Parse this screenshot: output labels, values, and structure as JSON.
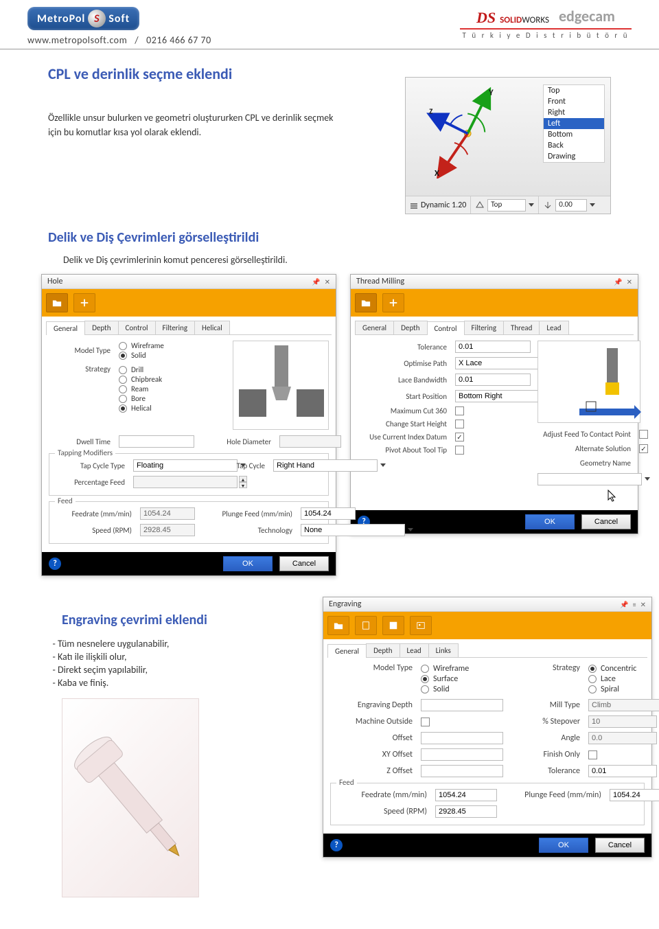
{
  "header": {
    "logo": {
      "left": "MetroPol",
      "right": "Soft"
    },
    "site": "www.metropolsoft.com",
    "sep": "/",
    "phone": "0216 466 67 70",
    "sw_brand_bold": "SOLID",
    "sw_brand_rest": "WORKS",
    "edgecam": "edgecam",
    "distributor": "T ü r k i y e   D i s t r i b ü t ö r ü"
  },
  "section1": {
    "title": "CPL ve derinlik seçme eklendi",
    "paragraph": "Özellikle unsur bulurken ve geometri oluştururken CPL ve derinlik seçmek için bu komutlar kısa yol olarak eklendi."
  },
  "axis": {
    "yLabel": "Y",
    "xLabel": "X",
    "zLabel": "Z",
    "views": [
      "Top",
      "Front",
      "Right",
      "Left",
      "Bottom",
      "Back",
      "Drawing"
    ],
    "selectedView": "Left",
    "dynamicLabel": "Dynamic 1.20",
    "topCombo": "Top",
    "depthValue": "0.00"
  },
  "section2": {
    "title": "Delik ve Diş Çevrimleri görselleştirildi",
    "subtitle": "Delik ve Diş çevrimlerinin komut penceresi görselleştirildi."
  },
  "hole": {
    "title": "Hole",
    "tabs": [
      "General",
      "Depth",
      "Control",
      "Filtering",
      "Helical"
    ],
    "activeTab": "General",
    "modelTypeLabel": "Model Type",
    "modelTypes": [
      "Wireframe",
      "Solid"
    ],
    "modelTypeSelected": "Solid",
    "strategyLabel": "Strategy",
    "strategies": [
      "Drill",
      "Chipbreak",
      "Ream",
      "Bore",
      "Helical"
    ],
    "strategySelected": "Helical",
    "dwellLabel": "Dwell Time",
    "holeDiaLabel": "Hole Diameter",
    "tappingTitle": "Tapping Modifiers",
    "tapCycleTypeLabel": "Tap Cycle Type",
    "tapCycleType": "Floating",
    "percentageFeedLabel": "Percentage Feed",
    "tapCycleLabel": "Tap Cycle",
    "tapCycle": "Right Hand",
    "feedTitle": "Feed",
    "feedrateLabel": "Feedrate (mm/min)",
    "feedrate": "1054.24",
    "plungeLabel": "Plunge Feed (mm/min)",
    "plunge": "1054.24",
    "speedLabel": "Speed (RPM)",
    "speed": "2928.45",
    "technologyLabel": "Technology",
    "technology": "None",
    "ok": "OK",
    "cancel": "Cancel"
  },
  "thread": {
    "title": "Thread Milling",
    "tabs": [
      "General",
      "Depth",
      "Control",
      "Filtering",
      "Thread",
      "Lead"
    ],
    "activeTab": "Control",
    "toleranceLabel": "Tolerance",
    "tolerance": "0.01",
    "optPathLabel": "Optimise Path",
    "optPath": "X Lace",
    "laceBwLabel": "Lace Bandwidth",
    "laceBw": "0.01",
    "startPosLabel": "Start Position",
    "startPos": "Bottom Right",
    "max360Label": "Maximum Cut 360",
    "changeStartLabel": "Change Start Height",
    "useIndexLabel": "Use Current Index Datum",
    "useIndexOn": true,
    "pivotLabel": "Pivot About Tool Tip",
    "adjustFeedLabel": "Adjust Feed To Contact Point",
    "altSolLabel": "Alternate Solution",
    "altSolOn": true,
    "geomNameLabel": "Geometry Name",
    "ok": "OK",
    "cancel": "Cancel"
  },
  "section3": {
    "title": "Engraving çevrimi eklendi",
    "bullets": [
      "Tüm nesnelere uygulanabilir,",
      "Katı ile ilişkili olur,",
      "Direkt seçim yapılabilir,",
      "Kaba ve finiş."
    ]
  },
  "engraving": {
    "title": "Engraving",
    "tabs": [
      "General",
      "Depth",
      "Lead",
      "Links"
    ],
    "activeTab": "General",
    "modelTypeLabel": "Model Type",
    "modelTypes": [
      "Wireframe",
      "Surface",
      "Solid"
    ],
    "modelTypeSelected": "Surface",
    "strategyLabel": "Strategy",
    "strategies": [
      "Concentric",
      "Lace",
      "Spiral"
    ],
    "strategySelected": "Concentric",
    "engravingDepthLabel": "Engraving Depth",
    "millTypeLabel": "Mill Type",
    "millType": "Climb",
    "machineOutsideLabel": "Machine Outside",
    "stepoverLabel": "% Stepover",
    "stepover": "10",
    "offsetLabel": "Offset",
    "angleLabel": "Angle",
    "angle": "0.0",
    "xyOffsetLabel": "XY Offset",
    "finishOnlyLabel": "Finish Only",
    "zOffsetLabel": "Z Offset",
    "toleranceLabel": "Tolerance",
    "tolerance": "0.01",
    "feedTitle": "Feed",
    "feedrateLabel": "Feedrate (mm/min)",
    "feedrate": "1054.24",
    "plungeLabel": "Plunge Feed (mm/min)",
    "plunge": "1054.24",
    "speedLabel": "Speed (RPM)",
    "speed": "2928.45",
    "ok": "OK",
    "cancel": "Cancel"
  }
}
